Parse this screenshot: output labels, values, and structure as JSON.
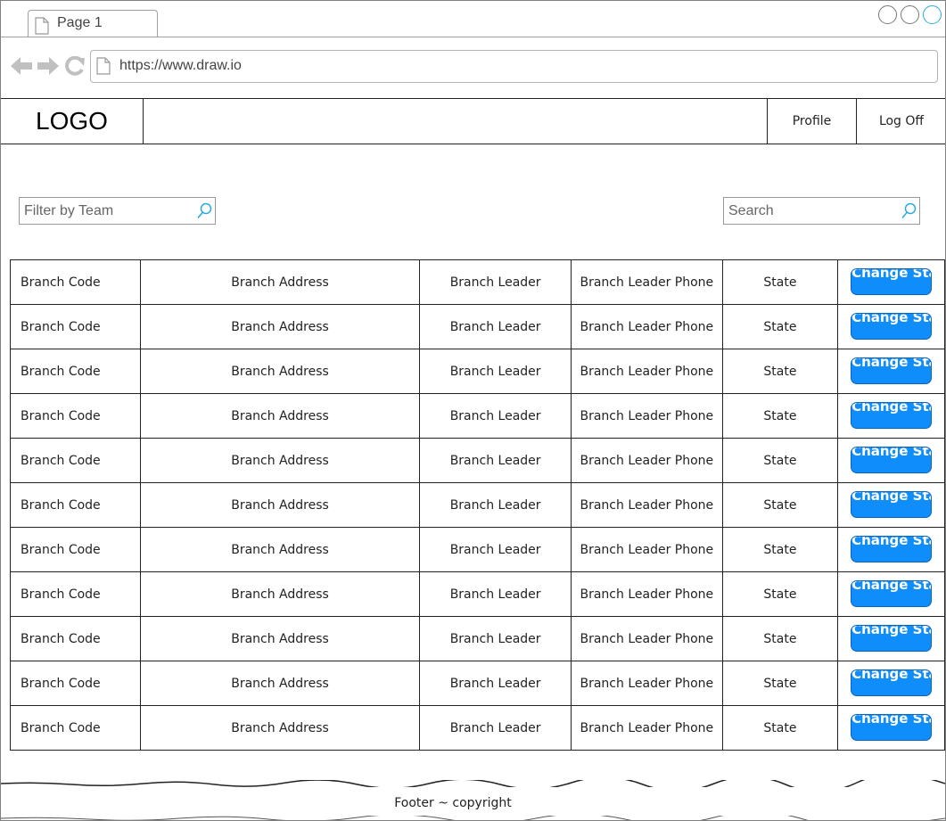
{
  "browser": {
    "tab_title": "Page 1",
    "url": "https://www.draw.io"
  },
  "header": {
    "logo": "LOGO",
    "profile_label": "Profile",
    "logoff_label": "Log Off"
  },
  "filter": {
    "placeholder": "Filter by Team"
  },
  "search": {
    "placeholder": "Search"
  },
  "table": {
    "rows": [
      [
        "Branch Code",
        "Branch Address",
        "Branch Leader",
        "Branch Leader Phone",
        "State",
        "Change State"
      ],
      [
        "Branch Code",
        "Branch Address",
        "Branch Leader",
        "Branch Leader Phone",
        "State",
        "Change State"
      ],
      [
        "Branch Code",
        "Branch Address",
        "Branch Leader",
        "Branch Leader Phone",
        "State",
        "Change State"
      ],
      [
        "Branch Code",
        "Branch Address",
        "Branch Leader",
        "Branch Leader Phone",
        "State",
        "Change State"
      ],
      [
        "Branch Code",
        "Branch Address",
        "Branch Leader",
        "Branch Leader Phone",
        "State",
        "Change State"
      ],
      [
        "Branch Code",
        "Branch Address",
        "Branch Leader",
        "Branch Leader Phone",
        "State",
        "Change State"
      ],
      [
        "Branch Code",
        "Branch Address",
        "Branch Leader",
        "Branch Leader Phone",
        "State",
        "Change State"
      ],
      [
        "Branch Code",
        "Branch Address",
        "Branch Leader",
        "Branch Leader Phone",
        "State",
        "Change State"
      ],
      [
        "Branch Code",
        "Branch Address",
        "Branch Leader",
        "Branch Leader Phone",
        "State",
        "Change State"
      ],
      [
        "Branch Code",
        "Branch Address",
        "Branch Leader",
        "Branch Leader Phone",
        "State",
        "Change State"
      ],
      [
        "Branch Code",
        "Branch Address",
        "Branch Leader",
        "Branch Leader Phone",
        "State",
        "Change State"
      ]
    ]
  },
  "footer": {
    "text": "Footer ~ copyright"
  },
  "icons": [
    "page-icon",
    "back-arrow-icon",
    "forward-arrow-icon",
    "reload-icon",
    "search-icon",
    "window-control-icon"
  ],
  "colors": {
    "button": "#0f8dfa",
    "accent": "#29a9e0"
  }
}
